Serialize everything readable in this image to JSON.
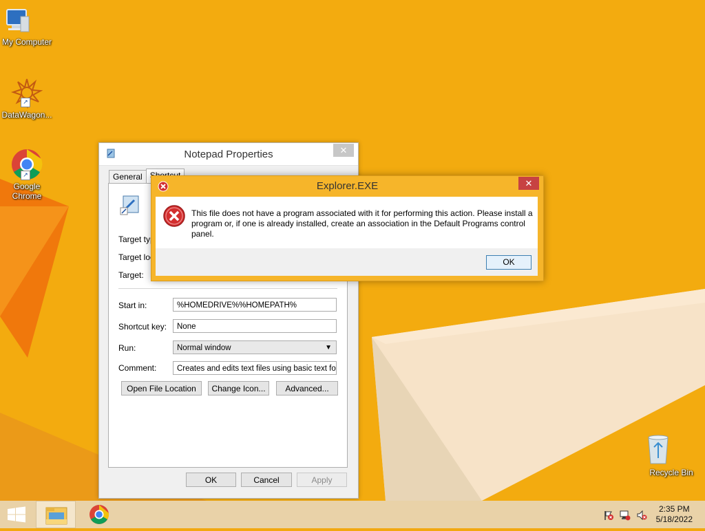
{
  "desktop": {
    "icons": [
      {
        "label": "My Computer",
        "icon": "computer-icon"
      },
      {
        "label": "DataWagon...",
        "icon": "datawagon-icon"
      },
      {
        "label": "Google Chrome",
        "icon": "chrome-icon"
      },
      {
        "label": "Recycle Bin",
        "icon": "recycle-bin-icon"
      }
    ]
  },
  "properties_window": {
    "title": "Notepad Properties",
    "close_label": "✕",
    "tabs": [
      "General",
      "Shortcut"
    ],
    "selected_tab": "Shortcut",
    "labels": {
      "target_type": "Target typ",
      "target_location": "Target loc",
      "target": "Target:",
      "start_in": "Start in:",
      "shortcut_key": "Shortcut key:",
      "run": "Run:",
      "comment": "Comment:"
    },
    "values": {
      "start_in": "%HOMEDRIVE%%HOMEPATH%",
      "shortcut_key": "None",
      "run": "Normal window",
      "comment": "Creates and edits text files using basic text form"
    },
    "buttons": {
      "open_file_location": "Open File Location",
      "change_icon": "Change Icon...",
      "advanced": "Advanced...",
      "ok": "OK",
      "cancel": "Cancel",
      "apply": "Apply"
    }
  },
  "error_dialog": {
    "title": "Explorer.EXE",
    "close_label": "✕",
    "message": "This file does not have a program associated with it for performing this action. Please install a program or, if one is already installed, create an association in the Default Programs control panel.",
    "ok_label": "OK"
  },
  "taskbar": {
    "time": "2:35 PM",
    "date": "5/18/2022"
  },
  "colors": {
    "desktop": "#f2a810",
    "error_frame": "#f6b52a",
    "error_close": "#c74242",
    "taskbar": "#e9d2a8"
  }
}
